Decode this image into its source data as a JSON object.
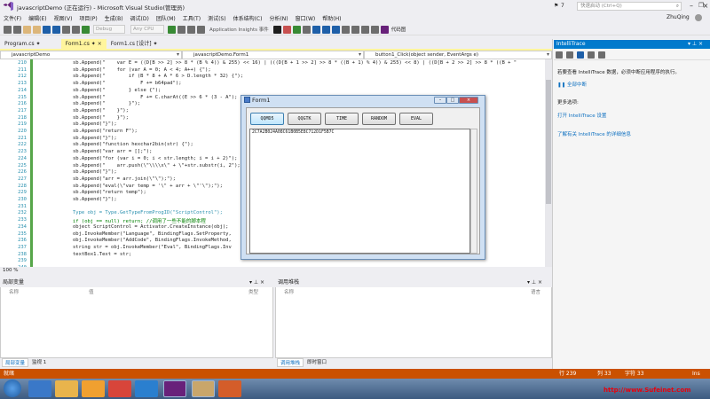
{
  "window": {
    "title": "javascriptDemo (正在运行) - Microsoft Visual Studio(管理员)",
    "notify_count": "7",
    "quick_launch": "快速启动 (Ctrl+Q)",
    "user": "ZhuQing"
  },
  "menu": [
    "文件(F)",
    "编辑(E)",
    "视图(V)",
    "项目(P)",
    "生成(B)",
    "调试(D)",
    "团队(M)",
    "工具(T)",
    "测试(S)",
    "体系结构(C)",
    "分析(N)",
    "窗口(W)",
    "帮助(H)"
  ],
  "toolbar": {
    "config": "Debug",
    "platform": "Any CPU",
    "insights": "Application Insights 事件",
    "map": "代码图"
  },
  "tabs": [
    {
      "label": "Program.cs ✦",
      "state": "normal"
    },
    {
      "label": "Form1.cs ✦ ×",
      "state": "active"
    },
    {
      "label": "Form1.cs [设计] ✦",
      "state": "normal"
    }
  ],
  "nav": {
    "project": "javascriptDemo",
    "class": "javascriptDemo.Form1",
    "member": "button1_Click(object sender, EventArgs e)"
  },
  "code": {
    "lines": [
      {
        "n": "210",
        "t": "sb.Append(\"    var E = ((D[B >> 2] >> 8 * (B % 4)) & 255) << 16) | (((D[B + 1 >> 2] >> 8 * ((B + 1) % 4)) & 255) << 8) | ((D[B + 2 >> 2] >> 8 * ((B + \"",
        "k": ""
      },
      {
        "n": "211",
        "t": "sb.Append(\"    for (var A = 0; A < 4; A++) {\");",
        "k": ""
      },
      {
        "n": "212",
        "t": "sb.Append(\"        if (B * 8 + A * 6 > D.length * 32) {\");",
        "k": ""
      },
      {
        "n": "213",
        "t": "sb.Append(\"            F += b64pad\");",
        "k": ""
      },
      {
        "n": "214",
        "t": "sb.Append(\"        } else {\");",
        "k": ""
      },
      {
        "n": "215",
        "t": "sb.Append(\"            F += C.charAt((E >> 6 * (3 - A\");",
        "k": ""
      },
      {
        "n": "216",
        "t": "sb.Append(\"        }\");",
        "k": ""
      },
      {
        "n": "217",
        "t": "sb.Append(\"    }\");",
        "k": ""
      },
      {
        "n": "218",
        "t": "sb.Append(\"    }\");",
        "k": ""
      },
      {
        "n": "219",
        "t": "sb.Append(\"}\");",
        "k": ""
      },
      {
        "n": "220",
        "t": "sb.Append(\"return F\");",
        "k": ""
      },
      {
        "n": "221",
        "t": "sb.Append(\"}\");",
        "k": ""
      },
      {
        "n": "222",
        "t": "sb.Append(\"function hexchar2bin(str) {\");",
        "k": ""
      },
      {
        "n": "223",
        "t": "sb.Append(\"var arr = [];\");",
        "k": ""
      },
      {
        "n": "224",
        "t": "sb.Append(\"for (var i = 0; i < str.length; i = i + 2)\");",
        "k": ""
      },
      {
        "n": "225",
        "t": "sb.Append(\"    arr.push(\\\"\\\\\\\\x\\\" + \\\"+str.substr(i, 2\");",
        "k": ""
      },
      {
        "n": "226",
        "t": "sb.Append(\"}\");",
        "k": ""
      },
      {
        "n": "227",
        "t": "sb.Append(\"arr = arr.join(\\\"\\\");\");",
        "k": ""
      },
      {
        "n": "228",
        "t": "sb.Append(\"eval(\\\"var temp = '\\\" + arr + \\\"'\\\");\");",
        "k": ""
      },
      {
        "n": "229",
        "t": "sb.Append(\"return temp\");",
        "k": ""
      },
      {
        "n": "230",
        "t": "sb.Append(\"}\");",
        "k": ""
      },
      {
        "n": "231",
        "t": "",
        "k": ""
      },
      {
        "n": "232",
        "t": "Type obj = Type.GetTypeFromProgID(\"ScriptControl\");",
        "k": "typ"
      },
      {
        "n": "233",
        "t": "if (obj == null) return; //调用了一些不能的脚本程",
        "k": "com"
      },
      {
        "n": "234",
        "t": "object ScriptControl = Activator.CreateInstance(obj);",
        "k": ""
      },
      {
        "n": "235",
        "t": "obj.InvokeMember(\"Language\", BindingFlags.SetProperty,",
        "k": ""
      },
      {
        "n": "236",
        "t": "obj.InvokeMember(\"AddCode\", BindingFlags.InvokeMethod,",
        "k": ""
      },
      {
        "n": "237",
        "t": "string str = obj.InvokeMember(\"Eval\", BindingFlags.Inv                                                   \" }).ToString();",
        "k": ""
      },
      {
        "n": "238",
        "t": "textBox1.Text = str;",
        "k": ""
      },
      {
        "n": "239",
        "t": "",
        "k": ""
      },
      {
        "n": "240",
        "t": "",
        "k": ""
      }
    ]
  },
  "editor": {
    "zoom": "100 %"
  },
  "form": {
    "title": "Form1",
    "buttons": [
      "QQMD5",
      "QQGTK",
      "TIME",
      "RANDOM",
      "EVAL"
    ],
    "textbox_value": "2C7A2B024A08C61B0B5E8C712D1F5B7C"
  },
  "intellitrace": {
    "title": "IntelliTrace",
    "msg": "若要查看 IntelliTrace 数据，必须中断应用程序的执行。",
    "break_all": "全部中断",
    "more": "更多选项:",
    "open_settings": "打开 IntelliTrace 设置",
    "learn_more": "了解有关 IntelliTrace 的详细信息"
  },
  "locals": {
    "title": "局部变量",
    "cols": [
      "名称",
      "值",
      "类型"
    ],
    "tabs": [
      "局部变量",
      "监视 1"
    ]
  },
  "callstack": {
    "title": "调用堆栈",
    "cols": [
      "名称",
      "语言"
    ],
    "tabs": [
      "调用堆栈",
      "即时窗口"
    ]
  },
  "status": {
    "left": "就绪",
    "line": "行 239",
    "col": "列 33",
    "ch": "字符 33",
    "ins": "Ins"
  },
  "taskbar": {
    "watermark": "http://www.Sufeinet.com"
  },
  "colors": {
    "status": "#ca5100",
    "accent": "#007acc",
    "tab_active": "#fff59d"
  }
}
